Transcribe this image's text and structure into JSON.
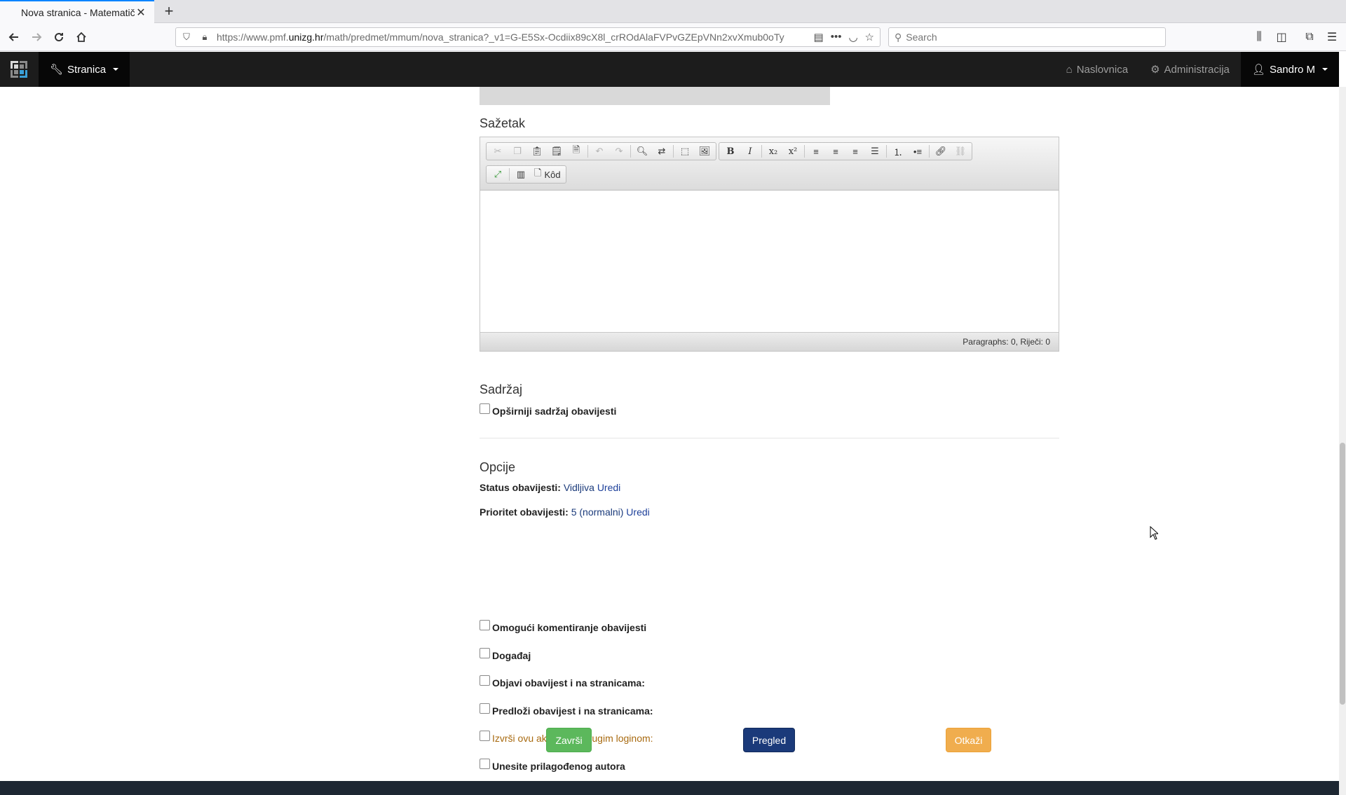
{
  "browser": {
    "tab_title": "Nova stranica - Matematičk",
    "url_prefix": "https://www.pmf.",
    "url_host": "unizg.hr",
    "url_path": "/math/predmet/mmum/nova_stranica?_v1=G-E5Sx-Ocdiix89cX8l_crROdAlaFVPvGZEpVNn2xvXmub0oTy",
    "search_placeholder": "Search"
  },
  "site_nav": {
    "menu_label": "Stranica",
    "links": [
      {
        "label": "Naslovnica",
        "icon": "home-icon"
      },
      {
        "label": "Administracija",
        "icon": "gear-icon"
      }
    ],
    "user_label": "Sandro M"
  },
  "summary_section": {
    "heading": "Sažetak",
    "editor": {
      "toolbar_code_label": "Kôd",
      "status_text": "Paragraphs: 0, Riječi: 0"
    }
  },
  "content_section": {
    "heading": "Sadržaj",
    "checkbox_label": "Opširniji sadržaj obavijesti"
  },
  "options_section": {
    "heading": "Opcije",
    "status": {
      "label": "Status obavijesti:",
      "value": "Vidljiva",
      "edit": "Uredi"
    },
    "priority": {
      "label": "Prioritet obavijesti:",
      "value": "5 (normalni)",
      "edit": "Uredi"
    },
    "checkboxes": [
      "Omogući komentiranje obavijesti",
      "Događaj",
      "Objavi obavijest i na stranicama:",
      "Predloži obavijest i na stranicama:",
      "Izvrši ovu akciju pod drugim loginom:",
      "Unesite prilagođenog autora"
    ]
  },
  "actions": {
    "finish": "Završi",
    "preview": "Pregled",
    "cancel": "Otkaži"
  }
}
